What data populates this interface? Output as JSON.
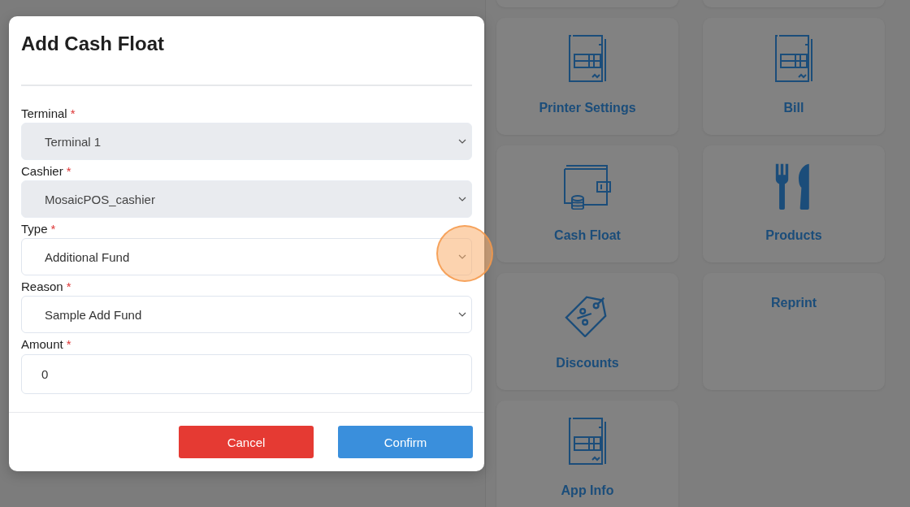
{
  "tile_rows": [
    {
      "tiles": [
        {
          "kind": "blank"
        },
        {
          "kind": "blank"
        }
      ]
    },
    {
      "tiles": [
        {
          "kind": "receipt",
          "label": "Printer Settings"
        },
        {
          "kind": "receipt",
          "label": "Bill"
        }
      ]
    },
    {
      "tiles": [
        {
          "kind": "wallet",
          "label": "Cash Float"
        },
        {
          "kind": "cutlery",
          "label": "Products"
        }
      ]
    },
    {
      "tiles": [
        {
          "kind": "tag",
          "label": "Discounts"
        },
        {
          "kind": "none",
          "label": "Reprint"
        }
      ]
    },
    {
      "tiles": [
        {
          "kind": "receipt",
          "label": "App Info"
        }
      ]
    }
  ],
  "modal": {
    "title": "Add Cash Float",
    "fields": [
      {
        "kind": "select",
        "label": "Terminal",
        "required": "*",
        "value": "Terminal 1",
        "disabled": true
      },
      {
        "kind": "select",
        "label": "Cashier",
        "required": "*",
        "value": "MosaicPOS_cashier",
        "disabled": true
      },
      {
        "kind": "select",
        "label": "Type",
        "required": "*",
        "value": "Additional Fund",
        "disabled": false
      },
      {
        "kind": "select",
        "label": "Reason",
        "required": "*",
        "value": "Sample Add Fund",
        "disabled": false
      },
      {
        "kind": "input",
        "label": "Amount",
        "required": "*",
        "value": "0",
        "disabled": false
      }
    ],
    "buttons": [
      {
        "kind": "cancel",
        "label": "Cancel"
      },
      {
        "kind": "confirm",
        "label": "Confirm"
      }
    ]
  }
}
